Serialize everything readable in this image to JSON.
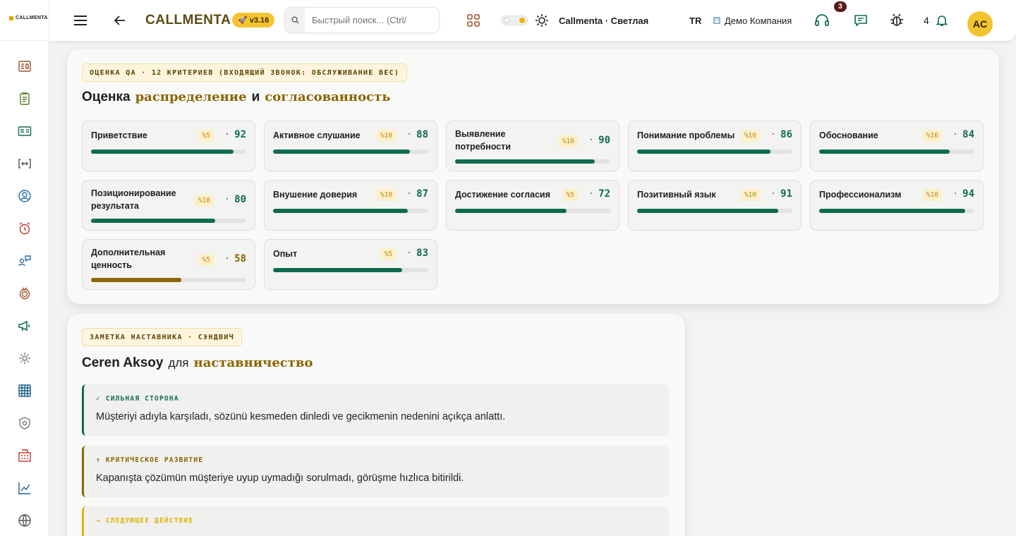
{
  "sidebar": {
    "logo_text": "CALLMENTA"
  },
  "header": {
    "brand": "CALLMENTA",
    "version": "v3.16",
    "search_placeholder": "Быстрый поиск... (Ctrl/",
    "theme_label": "Callmenta · Светлая",
    "language": "TR",
    "company": "Демо Компания",
    "chat_badge": "3",
    "notification_count": "4",
    "avatar_initials": "AC"
  },
  "qa": {
    "chip": "ОЦЕНКА QA · 12 КРИТЕРИЕВ (ВХОДЯЩИЙ ЗВОНОК: ОБСЛУЖИВАНИЕ ВЕС)",
    "title_prefix": "Оценка",
    "title_accent1": "распределение",
    "title_and": "и",
    "title_accent2": "согласованность",
    "criteria": [
      {
        "name": "Приветствие",
        "weight": "%5",
        "score": "92",
        "value": 92
      },
      {
        "name": "Активное слушание",
        "weight": "%10",
        "score": "88",
        "value": 88
      },
      {
        "name": "Выявление потребности",
        "weight": "%10",
        "score": "90",
        "value": 90
      },
      {
        "name": "Понимание проблемы",
        "weight": "%10",
        "score": "86",
        "value": 86
      },
      {
        "name": "Обоснование",
        "weight": "%10",
        "score": "84",
        "value": 84
      },
      {
        "name": "Позиционирование результата",
        "weight": "%10",
        "score": "80",
        "value": 80
      },
      {
        "name": "Внушение доверия",
        "weight": "%10",
        "score": "87",
        "value": 87
      },
      {
        "name": "Достижение согласия",
        "weight": "%5",
        "score": "72",
        "value": 72
      },
      {
        "name": "Позитивный язык",
        "weight": "%10",
        "score": "91",
        "value": 91
      },
      {
        "name": "Профессионализм",
        "weight": "%10",
        "score": "94",
        "value": 94
      },
      {
        "name": "Дополнительная ценность",
        "weight": "%5",
        "score": "58",
        "value": 58
      },
      {
        "name": "Опыт",
        "weight": "%5",
        "score": "83",
        "value": 83
      }
    ]
  },
  "coach": {
    "chip": "ЗАМЕТКА НАСТАВНИКА · СЭНДВИЧ",
    "title_name": "Ceren Aksoy",
    "title_for": "для",
    "title_accent": "наставничество",
    "notes": [
      {
        "head": "✓ СИЛЬНАЯ СТОРОНА",
        "text": "Müşteriyi adıyla karşıladı, sözünü kesmeden dinledi ve gecikmenin nedenini açıkça anlattı.",
        "color": "#0e6b52"
      },
      {
        "head": "↑ КРИТИЧЕСКОЕ РАЗВИТИЕ",
        "text": "Kapanışta çözümün müşteriye uyup uymadığı sorulmadı, görüşme hızlıca bitirildi.",
        "color": "#8a6500"
      },
      {
        "head": "→ СЛЕДУЮЩЕЕ ДЕЙСТВИЕ",
        "text": "",
        "color": "#e0b400"
      }
    ]
  }
}
